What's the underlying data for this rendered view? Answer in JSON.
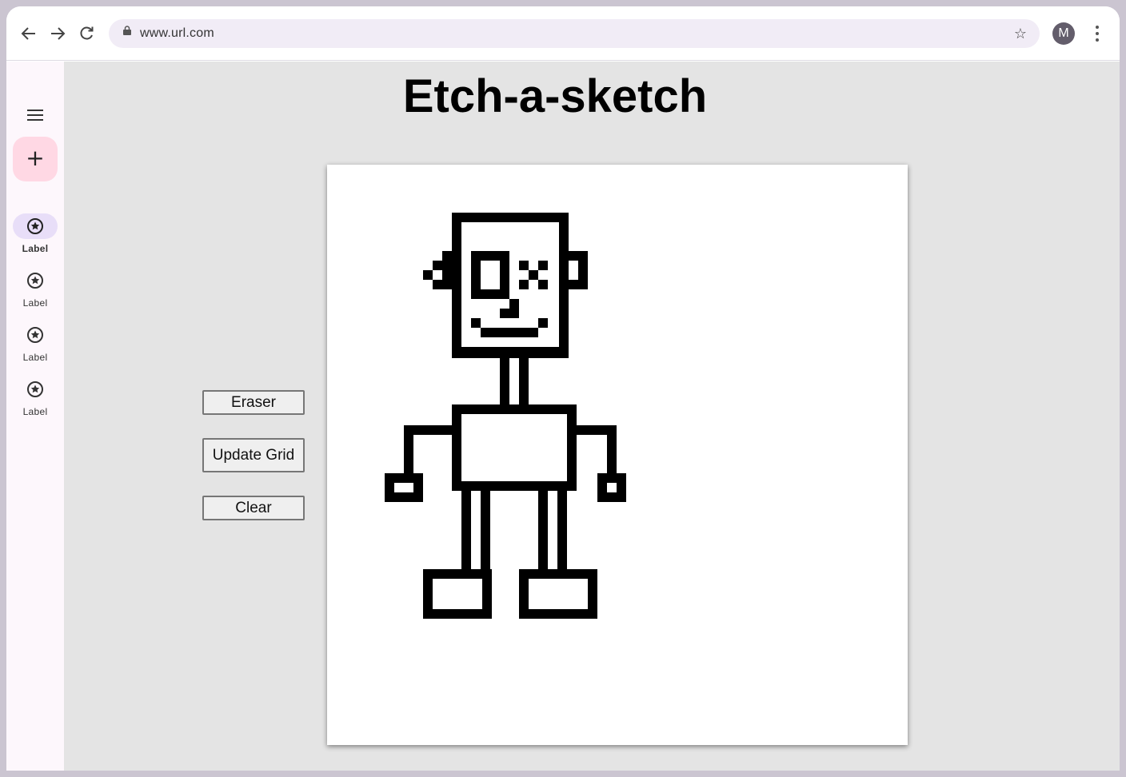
{
  "browser": {
    "url": "www.url.com",
    "avatar_letter": "M"
  },
  "rail": {
    "items": [
      {
        "label": "Label",
        "active": true
      },
      {
        "label": "Label",
        "active": false
      },
      {
        "label": "Label",
        "active": false
      },
      {
        "label": "Label",
        "active": false
      }
    ]
  },
  "app": {
    "title": "Etch-a-sketch",
    "buttons": {
      "eraser": "Eraser",
      "update_grid": "Update Grid",
      "clear": "Clear"
    },
    "colors": {
      "ink": "#000000",
      "canvas": "#ffffff",
      "background": "#e4e4e4"
    }
  }
}
